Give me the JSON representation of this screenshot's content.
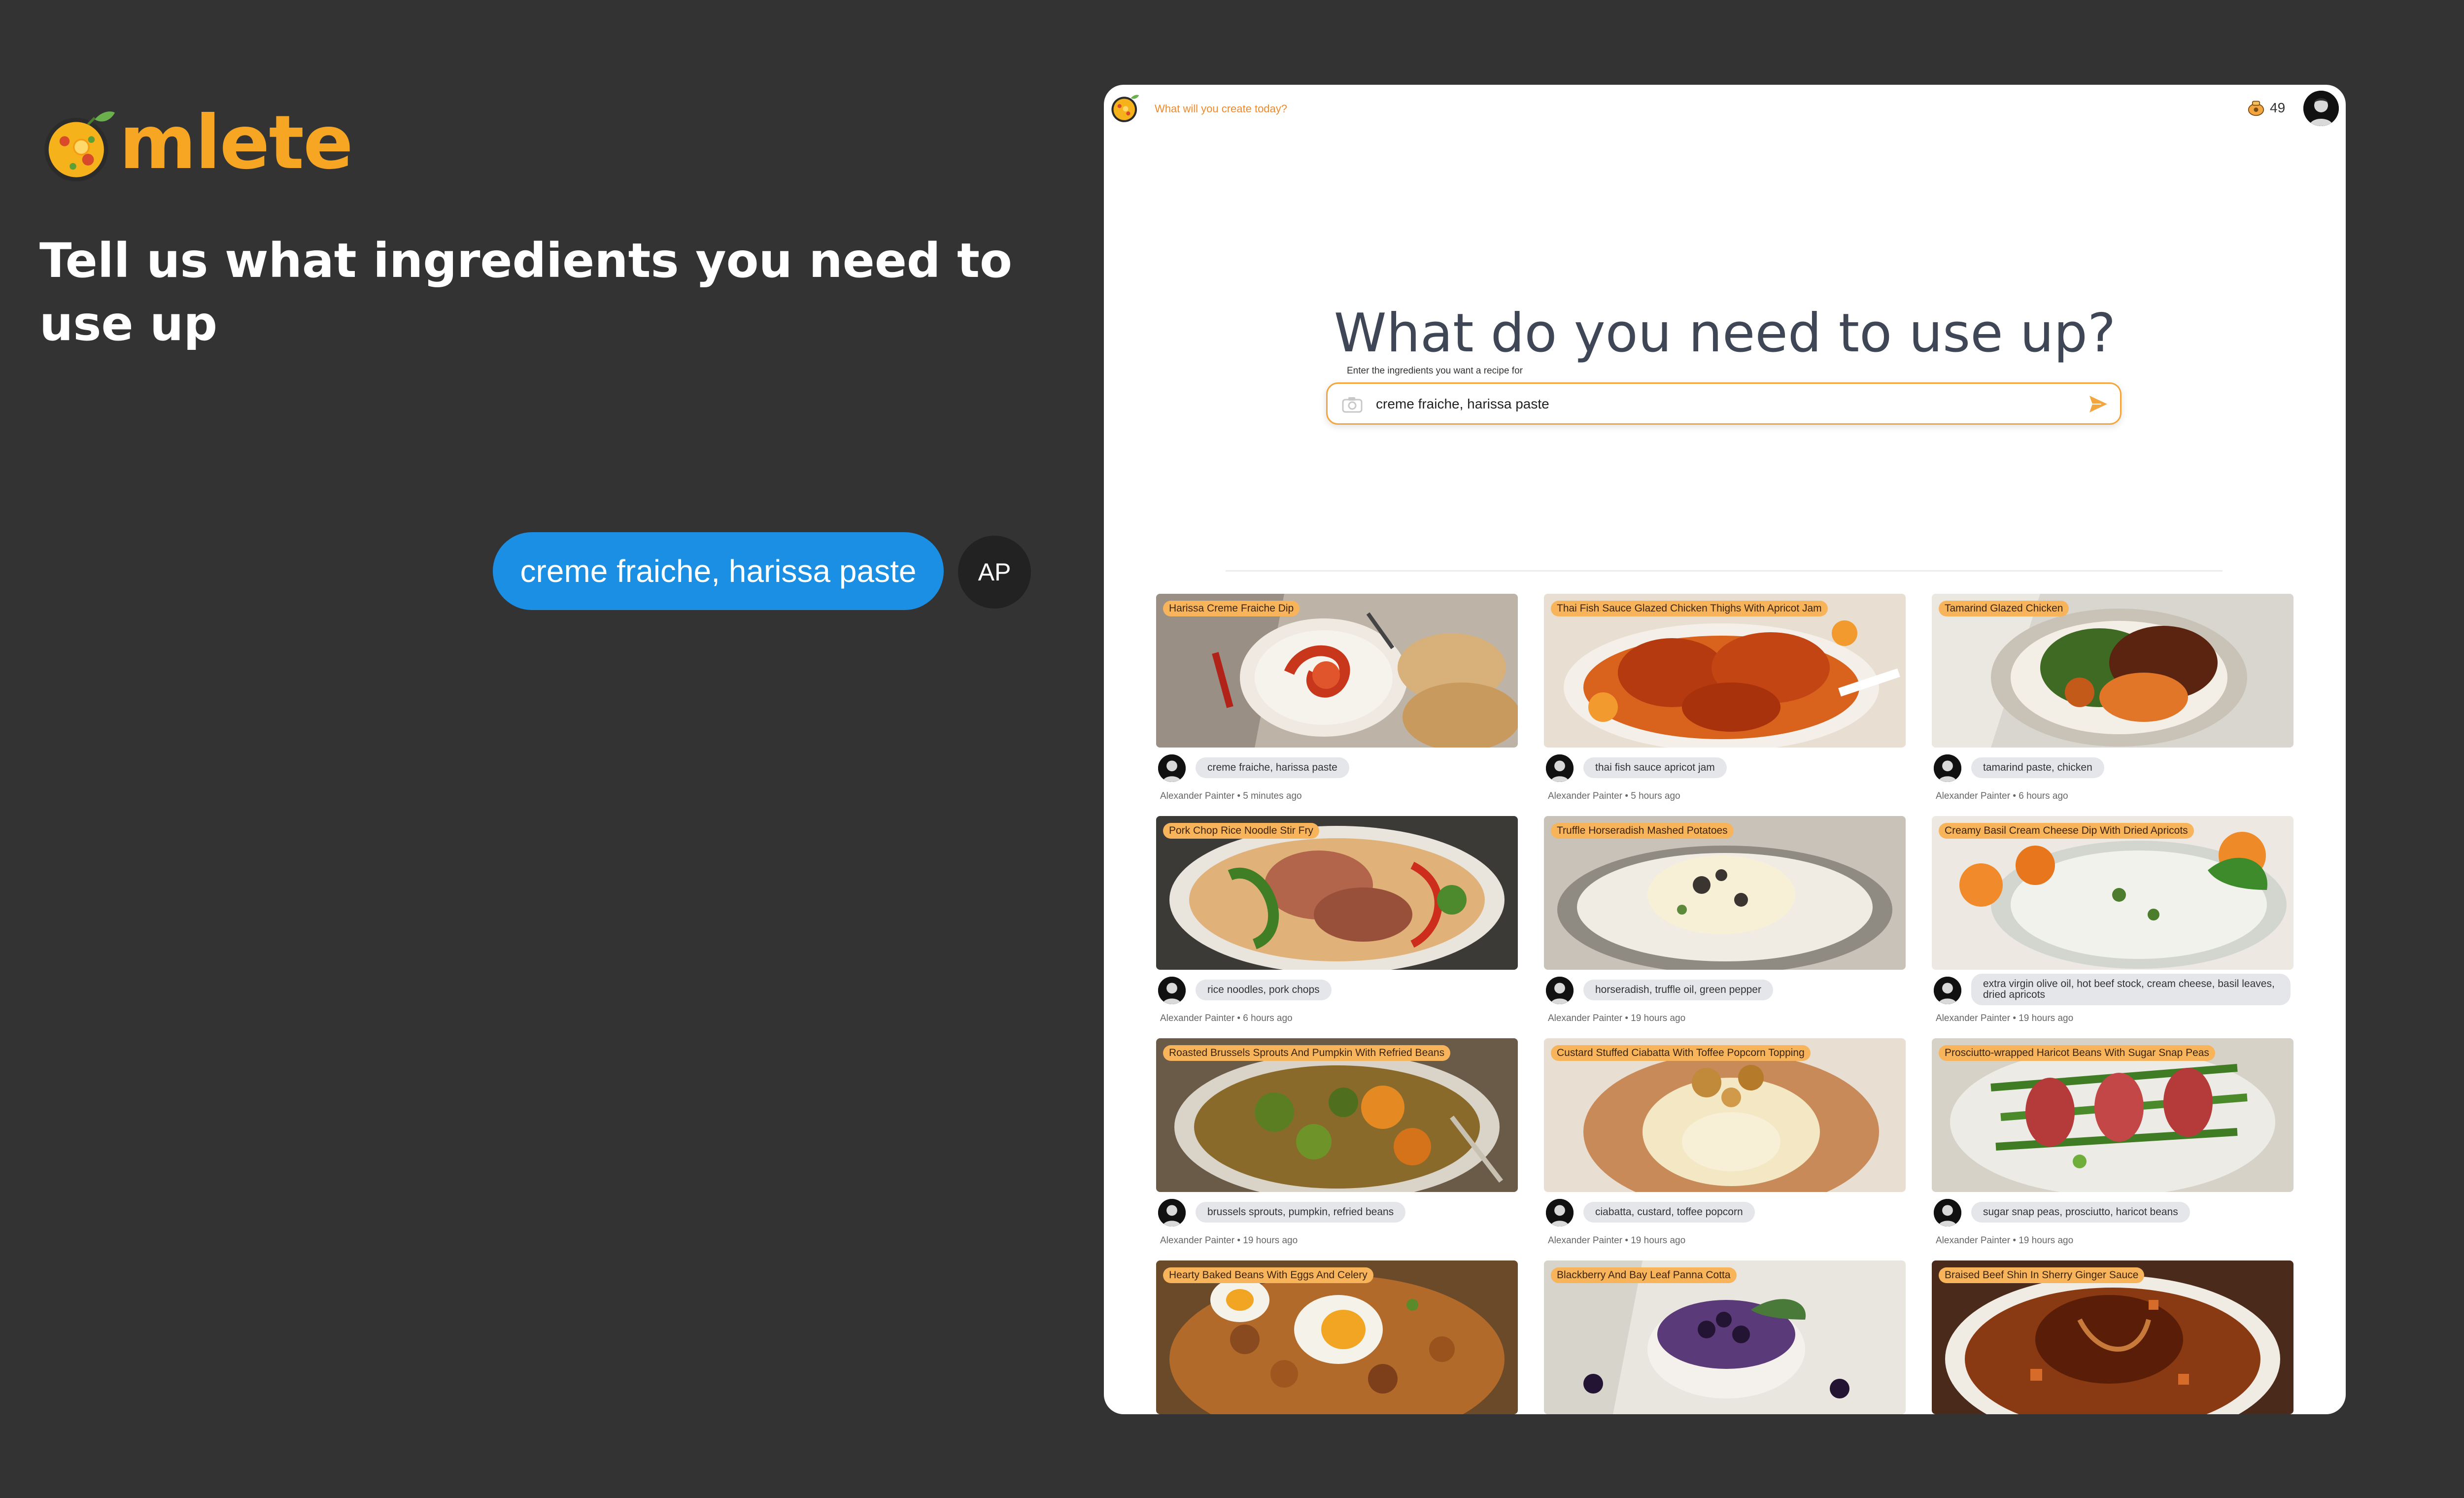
{
  "brand": {
    "word": "mlete",
    "logo_icon": "omelette-pan-logo-icon"
  },
  "headline": "Tell us what ingredients you need to use up",
  "chat": {
    "message": "creme fraiche, harissa paste",
    "avatar_initials": "AP"
  },
  "app": {
    "tagline": "What will you create today?",
    "credits": {
      "icon": "coin-pouch-icon",
      "count": "49"
    },
    "title": "What do you need to use up?",
    "input": {
      "label": "Enter the ingredients you want a recipe for",
      "value": "creme fraiche, harissa paste",
      "camera_icon": "camera-icon",
      "send_icon": "send-icon"
    },
    "colors": {
      "accent": "#f3a640",
      "badge": "#f8b45a",
      "bubble": "#1a8fe3"
    },
    "recipes": [
      {
        "title": "Harissa Creme Fraiche Dip",
        "ingredients": "creme fraiche, harissa paste",
        "byline": "Alexander Painter • 5 minutes ago"
      },
      {
        "title": "Thai Fish Sauce Glazed Chicken Thighs With Apricot Jam",
        "ingredients": "thai fish sauce apricot jam",
        "byline": "Alexander Painter • 5 hours ago"
      },
      {
        "title": "Tamarind Glazed Chicken",
        "ingredients": "tamarind paste, chicken",
        "byline": "Alexander Painter • 6 hours ago"
      },
      {
        "title": "Pork Chop Rice Noodle Stir Fry",
        "ingredients": "rice noodles, pork chops",
        "byline": "Alexander Painter • 6 hours ago"
      },
      {
        "title": "Truffle Horseradish Mashed Potatoes",
        "ingredients": "horseradish, truffle oil, green pepper",
        "byline": "Alexander Painter • 19 hours ago"
      },
      {
        "title": "Creamy Basil Cream Cheese Dip With Dried Apricots",
        "ingredients": "extra virgin olive oil, hot beef stock, cream cheese, basil leaves, dried apricots",
        "byline": "Alexander Painter • 19 hours ago"
      },
      {
        "title": "Roasted Brussels Sprouts And Pumpkin With Refried Beans",
        "ingredients": "brussels sprouts, pumpkin, refried beans",
        "byline": "Alexander Painter • 19 hours ago"
      },
      {
        "title": "Custard Stuffed Ciabatta With Toffee Popcorn Topping",
        "ingredients": "ciabatta, custard, toffee popcorn",
        "byline": "Alexander Painter • 19 hours ago"
      },
      {
        "title": "Prosciutto-wrapped Haricot Beans With Sugar Snap Peas",
        "ingredients": "sugar snap peas, prosciutto, haricot beans",
        "byline": "Alexander Painter • 19 hours ago"
      },
      {
        "title": "Hearty Baked Beans With Eggs And Celery",
        "ingredients": "",
        "byline": ""
      },
      {
        "title": "Blackberry And Bay Leaf Panna Cotta",
        "ingredients": "",
        "byline": ""
      },
      {
        "title": "Braised Beef Shin In Sherry Ginger Sauce",
        "ingredients": "",
        "byline": ""
      }
    ]
  }
}
